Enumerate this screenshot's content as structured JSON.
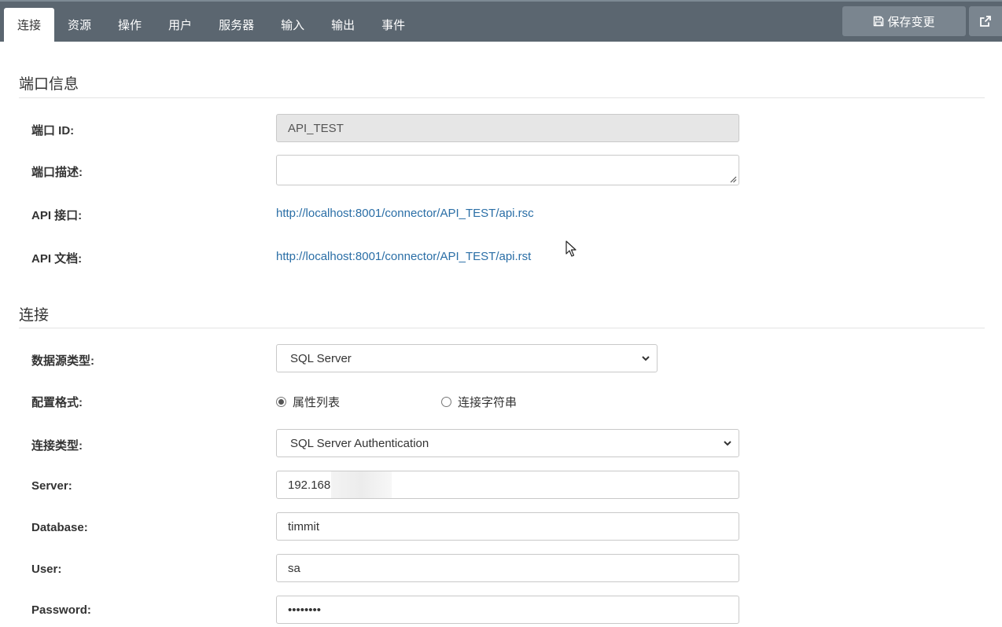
{
  "tabs": [
    {
      "label": "连接",
      "active": true
    },
    {
      "label": "资源",
      "active": false
    },
    {
      "label": "操作",
      "active": false
    },
    {
      "label": "用户",
      "active": false
    },
    {
      "label": "服务器",
      "active": false
    },
    {
      "label": "输入",
      "active": false
    },
    {
      "label": "输出",
      "active": false
    },
    {
      "label": "事件",
      "active": false
    }
  ],
  "toolbar": {
    "save_label": "保存变更",
    "save_icon": "floppy-disk-icon",
    "external_icon": "external-link-icon"
  },
  "port_info": {
    "title": "端口信息",
    "port_id_label": "端口 ID:",
    "port_id_value": "API_TEST",
    "port_desc_label": "端口描述:",
    "port_desc_value": "",
    "api_endpoint_label": "API 接口:",
    "api_endpoint_url": "http://localhost:8001/connector/API_TEST/api.rsc",
    "api_doc_label": "API 文档:",
    "api_doc_url": "http://localhost:8001/connector/API_TEST/api.rst"
  },
  "connection": {
    "title": "连接",
    "datasource_type_label": "数据源类型:",
    "datasource_type_value": "SQL Server",
    "config_format_label": "配置格式:",
    "config_format_options": [
      {
        "label": "属性列表",
        "checked": true
      },
      {
        "label": "连接字符串",
        "checked": false
      }
    ],
    "connection_type_label": "连接类型:",
    "connection_type_value": "SQL Server Authentication",
    "server_label": "Server:",
    "server_value": "192.168.",
    "database_label": "Database:",
    "database_value": "timmit",
    "user_label": "User:",
    "user_value": "sa",
    "password_label": "Password:",
    "password_value": "••••••••"
  },
  "colors": {
    "topbar": "#5b6670",
    "button": "#7a858f",
    "link": "#2a6ea6"
  }
}
